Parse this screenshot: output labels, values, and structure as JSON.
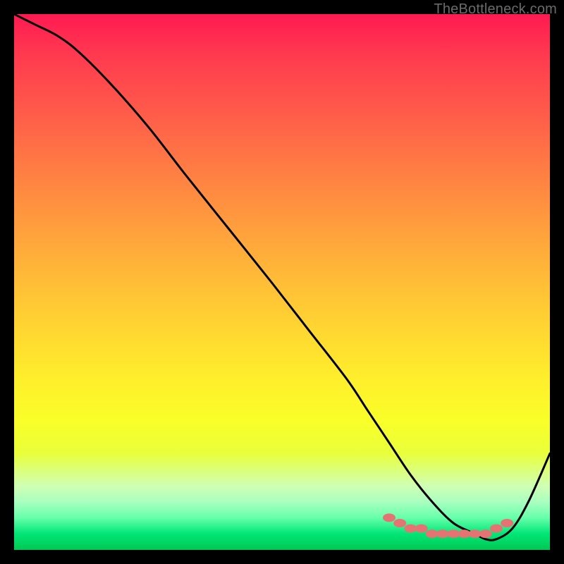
{
  "watermark": "TheBottleneck.com",
  "chart_data": {
    "type": "line",
    "title": "",
    "xlabel": "",
    "ylabel": "",
    "xlim": [
      0,
      100
    ],
    "ylim": [
      0,
      100
    ],
    "grid": false,
    "legend": false,
    "series": [
      {
        "name": "bottleneck-curve",
        "x": [
          0,
          2,
          4,
          8,
          12,
          18,
          25,
          32,
          40,
          48,
          55,
          62,
          66,
          70,
          74,
          78,
          82,
          86,
          88,
          90,
          93,
          96,
          100
        ],
        "y": [
          100,
          99,
          98,
          96,
          93,
          87,
          79,
          70,
          60,
          50,
          41,
          32,
          26,
          20,
          14,
          9,
          5,
          3,
          2,
          2,
          4,
          9,
          18
        ]
      },
      {
        "name": "highlight-dots",
        "x": [
          70,
          72,
          74,
          76,
          78,
          80,
          82,
          84,
          86,
          88,
          90,
          92
        ],
        "y": [
          6,
          5,
          4,
          4,
          3,
          3,
          3,
          3,
          3,
          3,
          4,
          5
        ]
      }
    ],
    "colors": {
      "curve": "#000000",
      "dots": "#e57373",
      "gradient_top": "#ff1a52",
      "gradient_mid": "#ffee2c",
      "gradient_bottom": "#00c853"
    }
  }
}
